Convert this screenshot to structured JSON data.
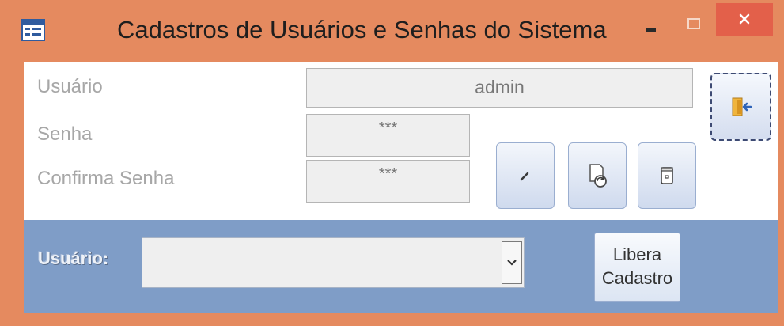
{
  "window": {
    "title": "Cadastros de Usuários e Senhas do Sistema",
    "accent_color": "#e58a5f",
    "close_color": "#e3604a"
  },
  "form": {
    "usuario_label": "Usuário",
    "usuario_value": "admin",
    "senha_label": "Senha",
    "senha_value": "***",
    "confirma_label": "Confirma Senha",
    "confirma_value": "***"
  },
  "toolbar": {
    "exit_icon": "exit-door-icon",
    "edit_icon": "pencil-icon",
    "refresh_icon": "document-refresh-icon",
    "delete_icon": "trash-icon"
  },
  "footer": {
    "usuario_label": "Usuário:",
    "usuario_select_value": "",
    "libera_line1": "Libera",
    "libera_line2": "Cadastro",
    "background_color": "#7f9dc7"
  }
}
